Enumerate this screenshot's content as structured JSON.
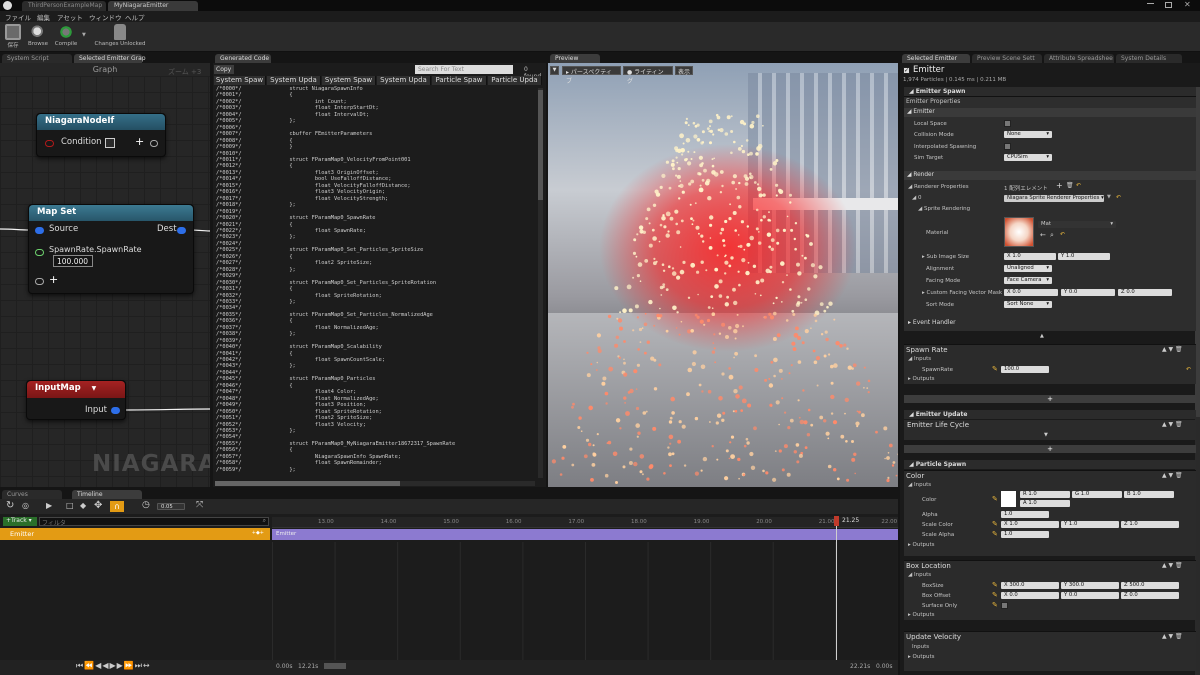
{
  "window": {
    "tabs": [
      "ThirdPersonExampleMap",
      "MyNiagaraEmitter"
    ]
  },
  "menu": [
    "ファイル",
    "編集",
    "アセット",
    "ウィンドウ",
    "ヘルプ"
  ],
  "toolbar": {
    "save": "保存",
    "browse": "Browse",
    "compile": "Compile",
    "changes": "Changes Unlocked"
  },
  "left_tabs": [
    "System Script",
    "Selected Emitter Grap"
  ],
  "graph": {
    "title": "Graph",
    "zoom": "ズーム +3",
    "watermark": "NIAGARA",
    "node_if": {
      "title": "NiagaraNodeIf",
      "pin": "Condition"
    },
    "map_set": {
      "title": "Map Set",
      "source": "Source",
      "dest": "Dest",
      "param": "SpawnRate.SpawnRate",
      "value": "100.000"
    },
    "input_map": {
      "title": "InputMap",
      "output": "Input"
    }
  },
  "code_panel": {
    "tab": "Generated Code",
    "copy": "Copy",
    "search_placeholder": "Search For Text",
    "found": "0 found",
    "columns": [
      "System Spaw",
      "System Upda",
      "System Spaw",
      "System Upda",
      "Particle Spaw",
      "Particle Upda"
    ],
    "lines": [
      "/*0000*/               struct NiagaraSpawnInfo",
      "/*0001*/               {",
      "/*0002*/                       int Count;",
      "/*0003*/                       float InterpStartDt;",
      "/*0004*/                       float IntervalDt;",
      "/*0005*/               };",
      "/*0006*/",
      "/*0007*/               cbuffer FEmitterParameters",
      "/*0008*/               {",
      "/*0009*/               }",
      "/*0010*/",
      "/*0011*/               struct FParamMap0_VelocityFromPoint001",
      "/*0012*/               {",
      "/*0013*/                       float3 OriginOffset;",
      "/*0014*/                       bool UseFalloffDistance;",
      "/*0015*/                       float VelocityFalloffDistance;",
      "/*0016*/                       float3 VelocityOrigin;",
      "/*0017*/                       float VelocityStrength;",
      "/*0018*/               };",
      "/*0019*/",
      "/*0020*/               struct FParamMap0_SpawnRate",
      "/*0021*/               {",
      "/*0022*/                       float SpawnRate;",
      "/*0023*/               };",
      "/*0024*/",
      "/*0025*/               struct FParamMap0_Set_Particles_SpriteSize",
      "/*0026*/               {",
      "/*0027*/                       float2 SpriteSize;",
      "/*0028*/               };",
      "/*0029*/",
      "/*0030*/               struct FParamMap0_Set_Particles_SpriteRotation",
      "/*0031*/               {",
      "/*0032*/                       float SpriteRotation;",
      "/*0033*/               };",
      "/*0034*/",
      "/*0035*/               struct FParamMap0_Set_Particles_NormalizedAge",
      "/*0036*/               {",
      "/*0037*/                       float NormalizedAge;",
      "/*0038*/               };",
      "/*0039*/",
      "/*0040*/               struct FParamMap0_Scalability",
      "/*0041*/               {",
      "/*0042*/                       float SpawnCountScale;",
      "/*0043*/               };",
      "/*0044*/",
      "/*0045*/               struct FParamMap0_Particles",
      "/*0046*/               {",
      "/*0047*/                       float4 Color;",
      "/*0048*/                       float NormalizedAge;",
      "/*0049*/                       float3 Position;",
      "/*0050*/                       float SpriteRotation;",
      "/*0051*/                       float2 SpriteSize;",
      "/*0052*/                       float3 Velocity;",
      "/*0053*/               };",
      "/*0054*/",
      "/*0055*/               struct FParamMap0_MyNiagaraEmitter18672317_SpawnRate",
      "/*0056*/               {",
      "/*0057*/                       NiagaraSpawnInfo SpawnRate;",
      "/*0058*/                       float SpawnRemainder;",
      "/*0059*/               };"
    ]
  },
  "preview": {
    "tab": "Preview",
    "perspective": "パースペクティブ",
    "lighting": "ライティング",
    "show": "表示"
  },
  "details": {
    "tabs": [
      "Selected Emitter",
      "Preview Scene Sett",
      "Attribute Spreadshee",
      "System Details"
    ],
    "emitter_title": "Emitter",
    "stats": "1,974 Particles | 0.145 ms | 0.211 MB",
    "emitter_spawn": "Emitter Spawn",
    "emitter_properties": "Emitter Properties",
    "emitter_group": "Emitter",
    "local_space": "Local Space",
    "collision_mode": "Collision Mode",
    "collision_value": "None",
    "interp_spawn": "Interpolated Spawning",
    "sim_target": "Sim Target",
    "sim_value": "CPUSim",
    "render": "Render",
    "renderer_props": "Renderer Properties",
    "renderer_count": "1 配列エレメント",
    "renderer_index": "0",
    "renderer_value": "Niagara Sprite Renderer Properties",
    "sprite_rendering": "Sprite Rendering",
    "material": "Material",
    "material_value": "Mat",
    "sub_image": "Sub Image Size",
    "sub_x": "1.0",
    "sub_y": "1.0",
    "alignment": "Alignment",
    "alignment_value": "Unaligned",
    "facing": "Facing Mode",
    "facing_value": "Face Camera",
    "custom_facing": "Custom Facing Vector Mask",
    "cf_x": "0.0",
    "cf_y": "0.0",
    "cf_z": "0.0",
    "sort": "Sort Mode",
    "sort_value": "Sort None",
    "event_handler": "Event Handler",
    "spawn_rate": "Spawn Rate",
    "inputs": "Inputs",
    "outputs": "Outputs",
    "spawn_rate_param": "SpawnRate",
    "spawn_rate_value": "100.0",
    "emitter_update": "Emitter Update",
    "emitter_life": "Emitter Life Cycle",
    "particle_spawn": "Particle Spawn",
    "color": "Color",
    "color_param": "Color",
    "color_r": "1.0",
    "color_g": "1.0",
    "color_b": "1.0",
    "color_a": "1.0",
    "alpha": "Alpha",
    "alpha_value": "1.0",
    "scale_color": "Scale Color",
    "sc_x": "1.0",
    "sc_y": "1.0",
    "sc_z": "1.0",
    "scale_alpha": "Scale Alpha",
    "scale_alpha_value": "1.0",
    "box_location": "Box Location",
    "box_size": "BoxSize",
    "bs_x": "300.0",
    "bs_y": "300.0",
    "bs_z": "500.0",
    "box_offset": "Box Offset",
    "bo_x": "0.0",
    "bo_y": "0.0",
    "bo_z": "0.0",
    "surface_only": "Surface Only",
    "update_velocity": "Update Velocity"
  },
  "timeline": {
    "tabs": [
      "Curves",
      "Timeline"
    ],
    "fps": "0.05",
    "track": "Track",
    "filter_placeholder": "フィルタ",
    "emitter": "Emitter",
    "bar_label": "Emitter",
    "ticks": [
      "13.00",
      "14.00",
      "15.00",
      "16.00",
      "17.00",
      "18.00",
      "19.00",
      "20.00",
      "21.00",
      "22.00"
    ],
    "playhead": "21.25",
    "start": "0.00s",
    "current": "12.21s",
    "end_a": "22.21s",
    "end_b": "0.00s"
  },
  "colors": {
    "accent": "#e39b14",
    "pin_blue": "#2d6ee8",
    "node_teal": "#2a6f85",
    "inputmap_red": "#9b1f1f",
    "emitter_bar": "#8c7ad0"
  }
}
